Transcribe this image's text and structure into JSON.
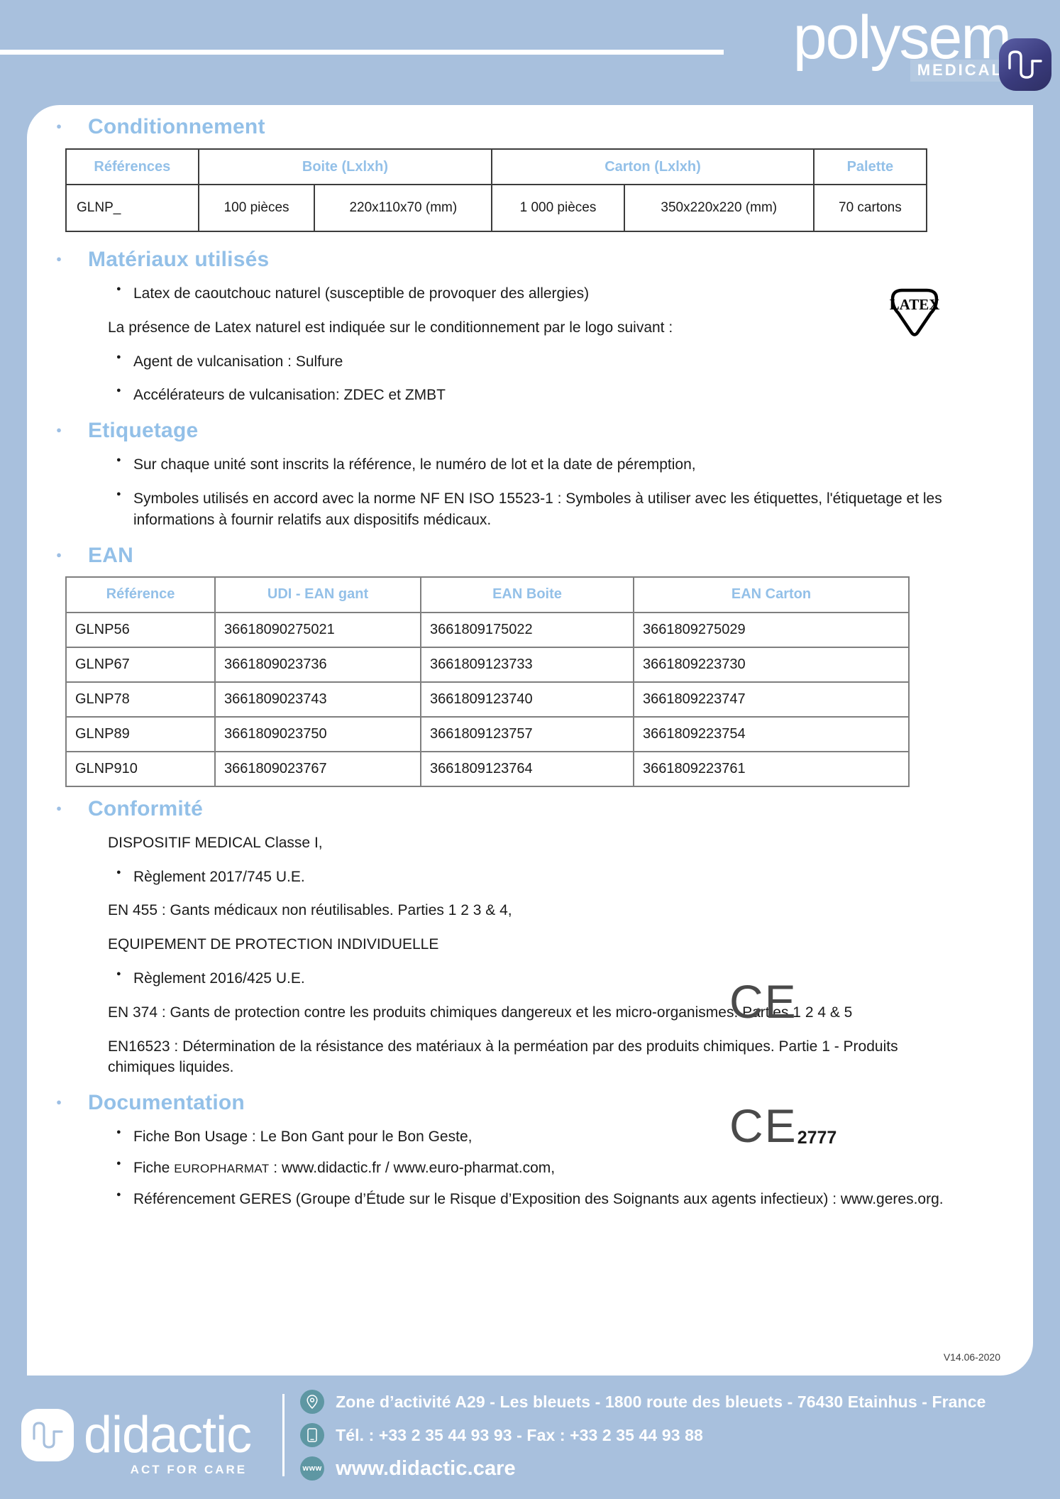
{
  "header": {
    "brand": "polysem",
    "brand_sub": "MEDICAL"
  },
  "sections": {
    "conditionnement": {
      "title": "Conditionnement"
    },
    "materiaux": {
      "title": "Matériaux utilisés"
    },
    "etiquetage": {
      "title": "Etiquetage"
    },
    "ean": {
      "title": "EAN"
    },
    "conformite": {
      "title": "Conformité"
    },
    "documentation": {
      "title": "Documentation"
    }
  },
  "conditionnement_table": {
    "headers": [
      "Références",
      "Boite (Lxlxh)",
      "Carton  (Lxlxh)",
      "Palette"
    ],
    "rows": [
      {
        "reference": "GLNP_",
        "boite_qty": "100 pièces",
        "boite_dim": "220x110x70 (mm)",
        "carton_qty": "1 000 pièces",
        "carton_dim": "350x220x220 (mm)",
        "palette": "70 cartons"
      }
    ]
  },
  "materiaux": {
    "bullet_1": "Latex de caoutchouc naturel (susceptible de provoquer des allergies)",
    "paragraph": "La présence de Latex naturel est indiquée sur le conditionnement par le logo suivant :",
    "bullet_2": "Agent de vulcanisation : Sulfure",
    "bullet_3": "Accélérateurs de vulcanisation: ZDEC et ZMBT",
    "latex_label": "LATEX"
  },
  "etiquetage": {
    "bullets": [
      "Sur chaque unité sont inscrits la référence, le numéro de lot et la date de péremption,",
      "Symboles utilisés en accord avec la norme NF EN ISO 15523-1 :  Symboles à utiliser avec les étiquettes, l'étiquetage et les informations à fournir relatifs aux dispositifs médicaux."
    ]
  },
  "ean_table": {
    "headers": [
      "Référence",
      "UDI - EAN gant",
      "EAN Boite",
      "EAN Carton"
    ],
    "rows": [
      {
        "reference": "GLNP56",
        "udi": "36618090275021",
        "boite": "3661809175022",
        "carton": "3661809275029"
      },
      {
        "reference": "GLNP67",
        "udi": "3661809023736",
        "boite": "3661809123733",
        "carton": "3661809223730"
      },
      {
        "reference": "GLNP78",
        "udi": "3661809023743",
        "boite": "3661809123740",
        "carton": "3661809223747"
      },
      {
        "reference": "GLNP89",
        "udi": "3661809023750",
        "boite": "3661809123757",
        "carton": "3661809223754"
      },
      {
        "reference": "GLNP910",
        "udi": "3661809023767",
        "boite": "3661809123764",
        "carton": "3661809223761"
      }
    ]
  },
  "conformite": {
    "line_1": "DISPOSITIF MEDICAL Classe I,",
    "bullet_1": "Règlement 2017/745 U.E.",
    "line_2": "EN 455 : Gants médicaux non réutilisables. Parties 1 2 3 & 4,",
    "line_3": "EQUIPEMENT DE PROTECTION INDIVIDUELLE",
    "bullet_2": "Règlement 2016/425 U.E.",
    "line_4": "EN 374 :  Gants de protection contre les produits chimiques dangereux et les micro-organismes. Parties  1 2 4 & 5",
    "line_5": "EN16523 : Détermination de la résistance des matériaux à la perméation par des produits chimiques. Partie 1 - Produits chimiques liquides.",
    "ce_mark": "CE",
    "ce_notified_body": "2777"
  },
  "documentation": {
    "bullets": [
      "Fiche Bon Usage : Le Bon Gant pour le Bon Geste,",
      "Fiche EUROPHARMAT : www.didactic.fr / www.euro-pharmat.com,",
      "Référencement GERES (Groupe d’Étude sur le Risque d’Exposition des Soignants aux agents infectieux) :  www.geres.org."
    ],
    "bullet_2_prefix": "Fiche ",
    "bullet_2_small": "EUROPHARMAT",
    "bullet_2_rest": " : www.didactic.fr / www.euro-pharmat.com,"
  },
  "version": "V14.06-2020",
  "footer": {
    "brand": "didactic",
    "tagline": "ACT FOR CARE",
    "address": "Zone d’activité A29 - Les bleuets - 1800 route des bleuets - 76430 Etainhus - France",
    "phone": "Tél. : +33 2 35 44 93 93 - Fax : +33 2 35 44 93 88",
    "website": "www.didactic.care",
    "www_label": "www"
  },
  "colors": {
    "page_background": "#a8c0dd",
    "heading_blue": "#93c0e8",
    "footer_icon": "#5e97a3",
    "badge_purple": "#3a3b7d"
  }
}
